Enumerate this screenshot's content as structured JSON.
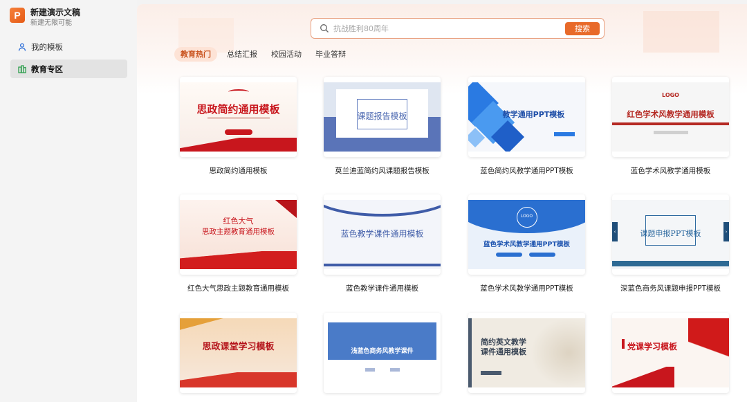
{
  "app": {
    "title": "新建演示文稿",
    "subtitle": "新建无限可能",
    "logo_letter": "P"
  },
  "sidebar": {
    "items": [
      {
        "label": "我的模板"
      },
      {
        "label": "教育专区"
      }
    ]
  },
  "search": {
    "placeholder": "抗战胜利80周年",
    "button": "搜索"
  },
  "tabs": [
    {
      "label": "教育热门"
    },
    {
      "label": "总结汇报"
    },
    {
      "label": "校园活动"
    },
    {
      "label": "毕业答辩"
    }
  ],
  "templates": [
    {
      "caption": "思政简约通用模板",
      "thumb_title": "思政简约通用模板"
    },
    {
      "caption": "莫兰迪蓝简约风课题报告模板",
      "thumb_title": "课题报告模板"
    },
    {
      "caption": "蓝色简约风教学通用PPT模板",
      "thumb_title": "教学通用PPT模板"
    },
    {
      "caption": "蓝色学术风教学通用模板",
      "thumb_title": "红色学术风教学通用模板",
      "thumb_logo": "LOGO"
    },
    {
      "caption": "红色大气思政主题教育通用模板",
      "thumb_title_line1": "红色大气",
      "thumb_title_line2": "思政主题教育通用模板"
    },
    {
      "caption": "蓝色教学课件通用模板",
      "thumb_title": "蓝色教学课件通用模板"
    },
    {
      "caption": "蓝色学术风教学通用PPT模板",
      "thumb_title": "蓝色学术风教学通用PPT模板",
      "thumb_logo": "LOGO"
    },
    {
      "caption": "深蓝色商务风课题申报PPT模板",
      "thumb_title": "课题申报PPT模板"
    },
    {
      "caption": "",
      "thumb_title": "思政课堂学习模板"
    },
    {
      "caption": "",
      "thumb_title": "浅蓝色商务风教学课件"
    },
    {
      "caption": "",
      "thumb_title_line1": "简约英文教学",
      "thumb_title_line2": "课件通用模板"
    },
    {
      "caption": "",
      "thumb_title": "党课学习模板"
    }
  ],
  "colors": {
    "accent": "#e86a2a",
    "tab_active_bg": "#fde3d6",
    "red": "#c8161d",
    "blue": "#1f6fdc"
  }
}
